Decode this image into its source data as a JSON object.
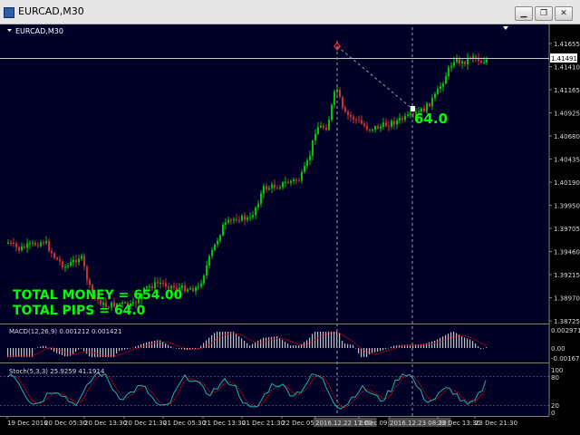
{
  "window": {
    "title": "EURCAD,M30",
    "minimize_glyph": "▁",
    "restore_glyph": "❐",
    "close_glyph": "✕"
  },
  "chart": {
    "symbol_label": "EURCAD,M30",
    "current_price": "1.41491"
  },
  "price_axis": [
    "1.41655",
    "1.41410",
    "1.41165",
    "1.40925",
    "1.40680",
    "1.40435",
    "1.40190",
    "1.39950",
    "1.39705",
    "1.39460",
    "1.39215",
    "1.38970",
    "1.38725"
  ],
  "overlay": {
    "total_money": "TOTAL MONEY = 654.00",
    "total_pips": "TOTAL PIPS = 64.0",
    "trade_pips": "64.0",
    "text_color": "#00ff00"
  },
  "macd": {
    "label": "MACD(12,26,9) 0.001212 0.001421",
    "axis": [
      "0.002971",
      "0.00",
      "-0.001679"
    ]
  },
  "stoch": {
    "label": "Stoch(5,3,3) 25.9259 41.1914",
    "axis": [
      "100",
      "80",
      "20",
      "0"
    ]
  },
  "time_axis": [
    "19 Dec 2016",
    "20 Dec 05:30",
    "20 Dec 13:30",
    "20 Dec 21:30",
    "21 Dec 05:30",
    "21 Dec 13:30",
    "21 Dec 21:30",
    "22 Dec 05:30",
    "2016.12.22 17:00",
    "2 Dec 09:30",
    "2016.12.23 08:30",
    "23 Dec 13:30",
    "23 Dec 21:30"
  ],
  "colors": {
    "bull": "#00c800",
    "bear": "#c83232",
    "background": "#000000",
    "panel_bg": "#010127",
    "grid": "#1e1e46",
    "macd_bars": "#c0c0c0",
    "macd_signal": "#ff0000",
    "stoch_main": "#20b2aa",
    "stoch_signal": "#ff0000"
  }
}
